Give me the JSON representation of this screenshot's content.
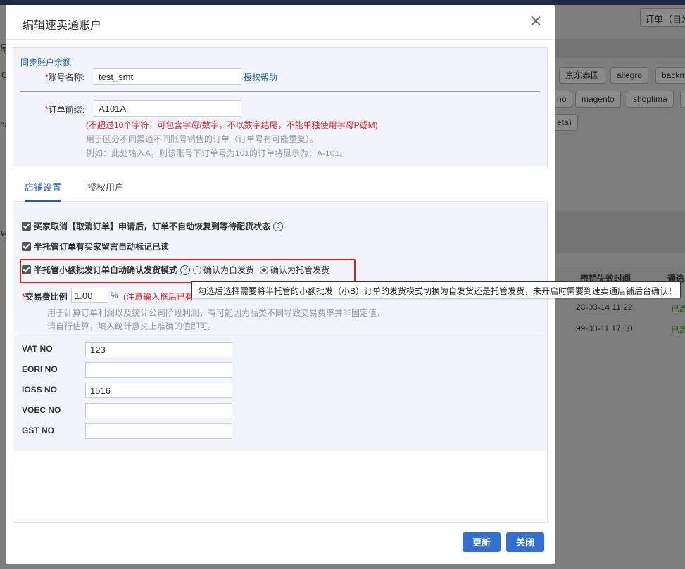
{
  "background": {
    "orders_button": "订单（自发",
    "platform_tags_row1": [
      "京东泰国",
      "allegro",
      "backm"
    ],
    "platform_tags_row2": [
      "no",
      "magento",
      "shoptima",
      "("
    ],
    "platform_tags_row3": [
      "eta)"
    ],
    "table_headers": [
      "密钥失效时间",
      "通途"
    ],
    "table_rows": [
      {
        "expire": "28-03-14 11:22",
        "status": "已启"
      },
      {
        "expire": "99-03-11 17:00",
        "status": "已启"
      }
    ],
    "left_edge_chars": [
      "昂",
      "C",
      "na",
      "号"
    ]
  },
  "dialog": {
    "title": "编辑速卖通账户",
    "sync_balance_link": "同步账户余额",
    "account_name_label": "账号名称:",
    "account_name_value": "test_smt",
    "auth_help_link": "授权帮助",
    "order_prefix_label": "订单前缀:",
    "order_prefix_value": "A101A",
    "prefix_rule_note": "(不超过10个字符，可包含字母/数字，不以数字结尾，不能单独使用字母P或M)",
    "prefix_hint_1": "用于区分不同渠道不同账号销售的订单（订单号有可能重复）。",
    "prefix_hint_2": "例如：此处输入A，则该账号下订单号为101的订单将显示为：A-101。"
  },
  "tabs": [
    {
      "label": "店铺设置",
      "active": true
    },
    {
      "label": "授权用户",
      "active": false
    }
  ],
  "settings": {
    "option1": "买家取消【取消订单】申请后，订单不自动恢复到等待配货状态",
    "option2": "半托管订单有买家留言自动标记已读",
    "option3": "半托管小额批发订单自动确认发货模式",
    "radio_self": "确认为自发货",
    "radio_managed": "确认为托管发货",
    "selected_radio": "radio_managed",
    "fee_label": "交易费比例",
    "fee_value": "1.00",
    "fee_unit": "%",
    "fee_note": "(注意输入框后已有",
    "fee_hint_1": "用于计算订单利润以及统计公司阶段利润，有可能因为品类不同导致交易费率并非固定值，",
    "fee_hint_2": "请自行估算，填入统计意义上准确的值即可。",
    "help_glyph": "?"
  },
  "tax_fields": [
    {
      "label": "VAT NO",
      "value": "123"
    },
    {
      "label": "EORI NO",
      "value": ""
    },
    {
      "label": "IOSS NO",
      "value": "1516"
    },
    {
      "label": "VOEC NO",
      "value": ""
    },
    {
      "label": "GST NO",
      "value": ""
    }
  ],
  "tooltip": "勾选后选择需要将半托管的小额批发（小B）订单的发货模式切换为自发货还是托管发货，未开启时需要到速卖通店铺后台确认！",
  "footer": {
    "update_label": "更新",
    "close_label": "关闭"
  },
  "colors": {
    "primary": "#2f6fd6",
    "link": "#1f5fbf",
    "error": "#e02020",
    "panel_bg": "#f1f5fb",
    "highlight_box": "#e02020"
  }
}
